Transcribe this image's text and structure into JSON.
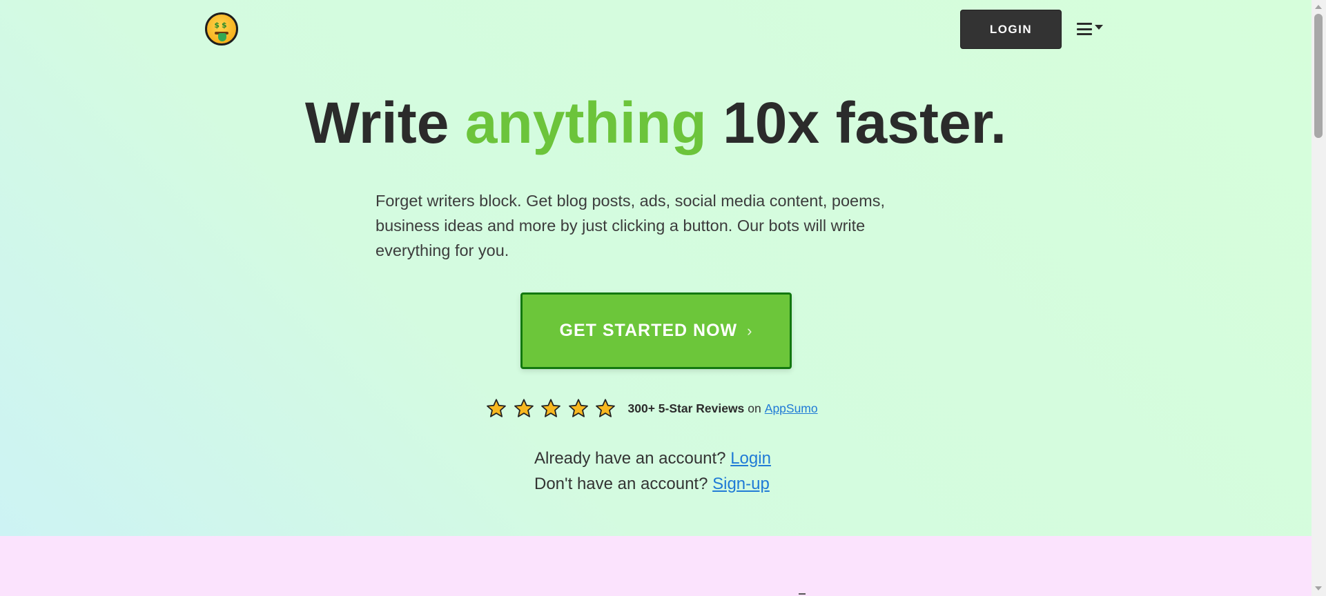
{
  "header": {
    "login_label": "LOGIN",
    "logo_icon": "money-mouth-face-icon",
    "menu_icon": "hamburger-menu-icon"
  },
  "hero": {
    "headline_before": "Write ",
    "headline_accent": "anything",
    "headline_after": " 10x faster.",
    "description": "Forget writers block. Get blog posts, ads, social media content, poems, business ideas and more by just clicking a button. Our bots will write everything for you.",
    "cta_label": "GET STARTED NOW",
    "cta_chevron": "›"
  },
  "reviews": {
    "stars": 5,
    "count_label": "300+ 5-Star Reviews",
    "on_label": "on",
    "platform_link": "AppSumo"
  },
  "account": {
    "have_account_text": "Already have an account?",
    "login_link": "Login",
    "no_account_text": "Don't have an account?",
    "signup_link": "Sign-up"
  },
  "colors": {
    "accent_green": "#6cc43b",
    "cta_border": "#12780f",
    "dark_button": "#333333",
    "link_blue": "#1f7ad6",
    "hero_bg": "#d6fedb",
    "section_pink": "#fbe3fd"
  }
}
